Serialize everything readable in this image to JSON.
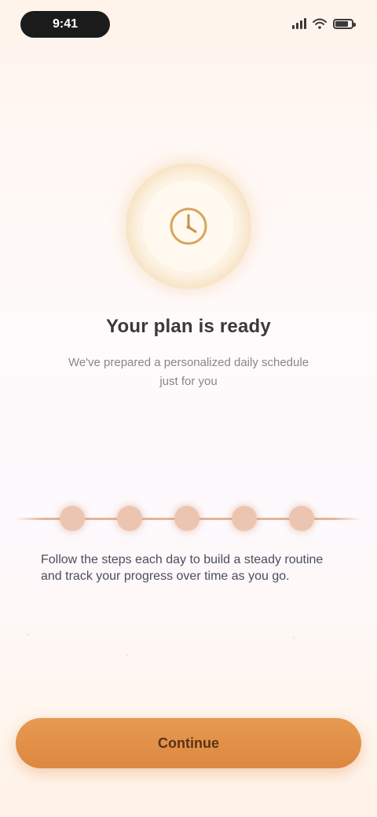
{
  "status_bar": {
    "time": "9:41",
    "signal_bars": 4,
    "battery_level": 0.8,
    "icons": [
      "signal-icon",
      "wifi-icon",
      "battery-icon"
    ]
  },
  "emblem": {
    "icon": "clock-icon",
    "accent_color": "#e8b468"
  },
  "content": {
    "headline": "Your plan is ready",
    "subtext": "We've prepared a personalized daily schedule just for you"
  },
  "steps": {
    "count": 5,
    "current": 5,
    "color": "#e3b49a"
  },
  "description": "Follow the steps each day to build a steady routine and track your progress over time as you go.",
  "footer_marks": {
    "left": "·",
    "middle": "·",
    "right": "·"
  },
  "cta": {
    "label": "Continue",
    "color": "#e08b45"
  }
}
